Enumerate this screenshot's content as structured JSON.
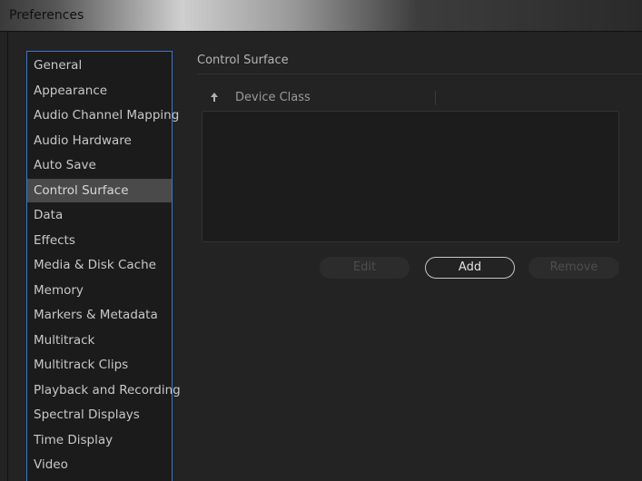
{
  "window": {
    "title": "Preferences"
  },
  "sidebar": {
    "items": [
      {
        "label": "General"
      },
      {
        "label": "Appearance"
      },
      {
        "label": "Audio Channel Mapping"
      },
      {
        "label": "Audio Hardware"
      },
      {
        "label": "Auto Save"
      },
      {
        "label": "Control Surface",
        "selected": true
      },
      {
        "label": "Data"
      },
      {
        "label": "Effects"
      },
      {
        "label": "Media & Disk Cache"
      },
      {
        "label": "Memory"
      },
      {
        "label": "Markers & Metadata"
      },
      {
        "label": "Multitrack"
      },
      {
        "label": "Multitrack Clips"
      },
      {
        "label": "Playback and Recording"
      },
      {
        "label": "Spectral Displays"
      },
      {
        "label": "Time Display"
      },
      {
        "label": "Video"
      }
    ]
  },
  "panel": {
    "section_title": "Control Surface",
    "table": {
      "sort_icon": "arrow-up-icon",
      "columns": [
        "Device Class"
      ],
      "rows": []
    },
    "buttons": {
      "edit": {
        "label": "Edit",
        "enabled": false
      },
      "add": {
        "label": "Add",
        "enabled": true
      },
      "remove": {
        "label": "Remove",
        "enabled": false
      }
    }
  },
  "colors": {
    "accent": "#3e76c4",
    "selected_bg": "#4a4a4a",
    "window_bg": "#232323"
  }
}
